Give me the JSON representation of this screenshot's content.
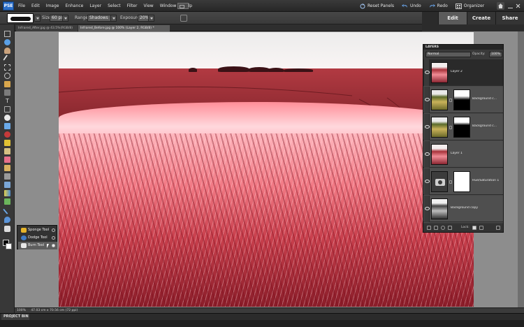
{
  "menubar": {
    "logo": "PSE",
    "items": [
      "File",
      "Edit",
      "Image",
      "Enhance",
      "Layer",
      "Select",
      "Filter",
      "View",
      "Window",
      "Help"
    ],
    "reset_panels": "Reset Panels",
    "undo": "Undo",
    "redo": "Redo",
    "organizer": "Organizer"
  },
  "options": {
    "size_label": "Size:",
    "size_value": "60 px",
    "range_label": "Range:",
    "range_value": "Shadows",
    "exposure_label": "Exposure:",
    "exposure_value": "20%"
  },
  "mode_tabs": [
    "Edit",
    "Create",
    "Share"
  ],
  "doc_tabs": [
    {
      "label": "Infrared_After.jpg @ 43.5%(RGB/8)",
      "active": false
    },
    {
      "label": "Infrared_Before.jpg @ 100% (Layer 2, RGB/8) *",
      "active": true
    }
  ],
  "flyout": {
    "items": [
      {
        "label": "Sponge Tool",
        "selected": false
      },
      {
        "label": "Dodge Tool",
        "selected": false
      },
      {
        "label": "Burn Tool",
        "selected": true
      }
    ]
  },
  "status": {
    "zoom": "100%",
    "dimensions": "47.03 cm x 70.56 cm (72 ppi)"
  },
  "bin_label": "PROJECT BIN",
  "layers": {
    "title": "LAYERS",
    "blend_mode": "Normal",
    "opacity_label": "Opacity:",
    "opacity_value": "100%",
    "lock_label": "Lock:",
    "rows": [
      {
        "name": "Layer 2",
        "selected": true,
        "has_mask": false
      },
      {
        "name": "Background c...",
        "selected": false,
        "has_mask": true
      },
      {
        "name": "Background c...",
        "selected": false,
        "has_mask": true
      },
      {
        "name": "Layer 1",
        "selected": false,
        "has_mask": false
      },
      {
        "name": "Hue/Saturation 1",
        "selected": false,
        "has_mask": true
      },
      {
        "name": "Background copy",
        "selected": false,
        "has_mask": false
      }
    ]
  },
  "colors": {
    "accent": "#2a6ec9",
    "field_red": "#b23a42",
    "wheat_pink": "#f27a85"
  }
}
